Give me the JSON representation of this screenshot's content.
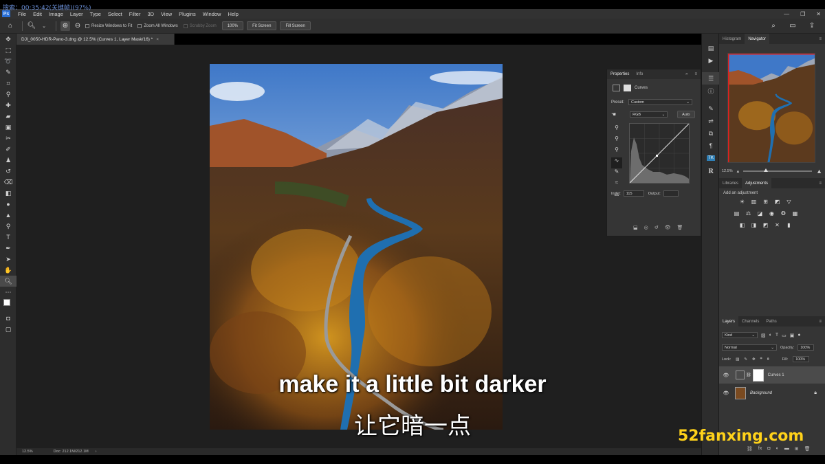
{
  "overlay": {
    "timestamp": "搜索：00:35:42(关键帧)(97%)"
  },
  "app": {
    "logo": "Ps"
  },
  "menu": [
    "File",
    "Edit",
    "Image",
    "Layer",
    "Type",
    "Select",
    "Filter",
    "3D",
    "View",
    "Plugins",
    "Window",
    "Help"
  ],
  "options": {
    "resize_windows": "Resize Windows to Fit",
    "zoom_all": "Zoom All Windows",
    "scrubby": "Scrubby Zoom",
    "zoom_100": "100%",
    "fit_screen": "Fit Screen",
    "fill_screen": "Fill Screen"
  },
  "document": {
    "tab_title": "DJI_0050-HDR-Pano-3.dng @ 12.5% (Curves 1, Layer Mask/16) *",
    "close": "×",
    "status_zoom": "12.5%",
    "status_doc": "Doc: 212.1M/212.1M"
  },
  "properties": {
    "tabs": [
      "Properties",
      "Info"
    ],
    "title": "Curves",
    "preset_label": "Preset:",
    "preset_value": "Custom",
    "channel": "RGB",
    "auto": "Auto",
    "input_label": "Input:",
    "input_value": "115",
    "output_label": "Output:"
  },
  "right": {
    "top_tabs": [
      "Histogram",
      "Navigator"
    ],
    "nav_zoom": "12.5%",
    "mid_tabs": [
      "Libraries",
      "Adjustments"
    ],
    "add_adjustment": "Add an adjustment",
    "layer_tabs": [
      "Layers",
      "Channels",
      "Paths"
    ],
    "kind": "Kind",
    "blend_mode": "Normal",
    "opacity_label": "Opacity:",
    "opacity_value": "100%",
    "lock_label": "Lock:",
    "fill_label": "Fill:",
    "fill_value": "100%",
    "layers": [
      "Curves 1",
      "Background"
    ]
  },
  "subtitles": {
    "english": "make it a little bit darker",
    "chinese": "让它暗一点"
  },
  "watermark": "52fanxing.com"
}
